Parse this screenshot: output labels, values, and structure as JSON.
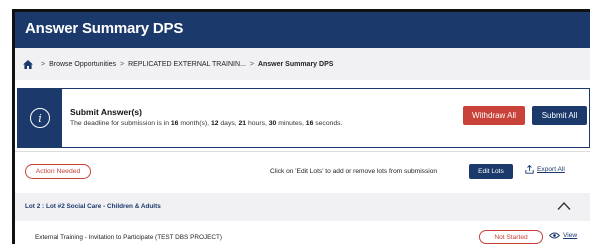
{
  "header": {
    "title": "Answer Summary DPS"
  },
  "breadcrumb": {
    "items": [
      "Browse Opportunities",
      "REPLICATED EXTERNAL TRAININ...",
      "Answer Summary DPS"
    ],
    "separator": ">"
  },
  "submit_panel": {
    "info_glyph": "i",
    "heading": "Submit Answer(s)",
    "deadline_prefix": "The deadline for submission is in",
    "months": "16",
    "months_unit": "month(s),",
    "days": "12",
    "days_unit": "days,",
    "hours": "21",
    "hours_unit": "hours,",
    "minutes": "30",
    "minutes_unit": "minutes,",
    "seconds": "16",
    "seconds_unit": "seconds.",
    "withdraw_label": "Withdraw All",
    "submit_label": "Submit All"
  },
  "actions": {
    "status_badge": "Action Needed",
    "hint": "Click on 'Edit Lots' to add or remove lots from submission",
    "edit_lots_label": "Edit Lots",
    "export_label": "Export All"
  },
  "lot": {
    "title": "Lot 2 : Lot #2 Social Care - Children & Adults",
    "rows": [
      {
        "name": "External Training - Invitation to Participate (TEST DBS PROJECT)",
        "status": "Not Started",
        "action": "View"
      }
    ]
  },
  "colors": {
    "brand": "#1b3a6b",
    "danger": "#c9423a",
    "muted_bg": "#f1f1f4"
  },
  "icons": [
    "home-icon",
    "info-icon",
    "export-icon",
    "chevron-up-icon",
    "eye-icon"
  ]
}
